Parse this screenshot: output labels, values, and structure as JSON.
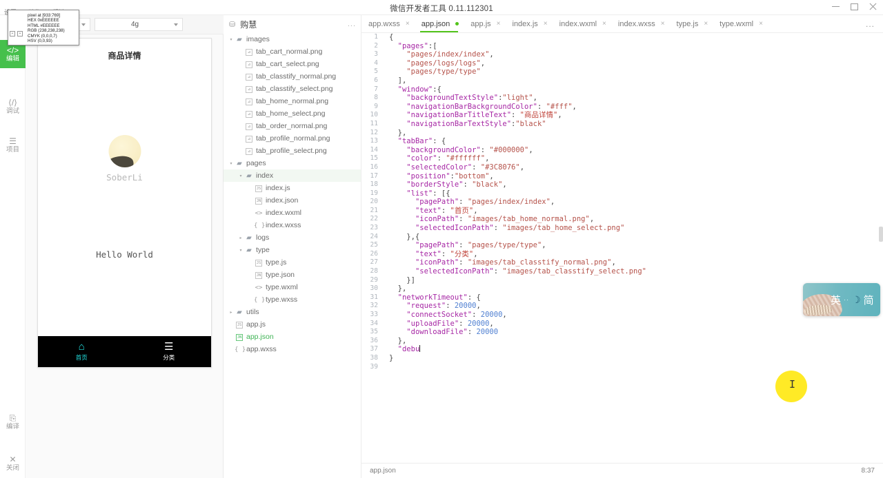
{
  "window": {
    "title": "微信开发者工具 0.11.112301",
    "controls": {
      "minimize": "minimize-icon",
      "maximize": "maximize-icon",
      "close": "close-icon"
    }
  },
  "menubar": {
    "items": [
      "设置",
      "动作",
      "超链"
    ]
  },
  "color_picker": {
    "pixel": "pixel at [933:769]",
    "hex": "HEX 0xEEEEEE",
    "html": "HTML #EEEEEE",
    "rgb": "RGB (238,238,238)",
    "cmyk": "CMYK (0,0,0,7)",
    "hsv": "HSV (0,0,93)",
    "swatch_a": "+",
    "swatch_b": "+"
  },
  "rail": {
    "items": [
      {
        "glyph": "</>",
        "label": "编辑",
        "active": true,
        "name": "rail-item-edit"
      },
      {
        "glyph": "⟨/⟩",
        "label": "调试",
        "active": false,
        "name": "rail-item-debug"
      },
      {
        "glyph": "☰",
        "label": "项目",
        "active": false,
        "name": "rail-item-project"
      }
    ],
    "bottom_items": [
      {
        "glyph": "⎘",
        "label": "编译",
        "name": "rail-item-compile"
      },
      {
        "glyph": "✕",
        "label": "关闭",
        "name": "rail-item-close"
      }
    ]
  },
  "simulator": {
    "device_select": "",
    "network_select": "4g",
    "phone": {
      "nav_title": "商品详情",
      "user_name": "SoberLi",
      "body_text": "Hello World",
      "tabbar": {
        "background": "#000000",
        "items": [
          {
            "icon": "home-icon",
            "glyph": "⌂",
            "label": "首页",
            "color": "#22e0e0",
            "selected": true
          },
          {
            "icon": "list-icon",
            "glyph": "☰",
            "label": "分类",
            "color": "#ffffff",
            "selected": false
          }
        ]
      }
    }
  },
  "explorer": {
    "project_name": "购慧",
    "more_label": "...",
    "tree": [
      {
        "depth": 0,
        "twisty": "▾",
        "icon": "folder",
        "label": "images"
      },
      {
        "depth": 1,
        "twisty": "",
        "icon": "png",
        "label": "tab_cart_normal.png"
      },
      {
        "depth": 1,
        "twisty": "",
        "icon": "png",
        "label": "tab_cart_select.png"
      },
      {
        "depth": 1,
        "twisty": "",
        "icon": "png",
        "label": "tab_classtify_normal.png"
      },
      {
        "depth": 1,
        "twisty": "",
        "icon": "png",
        "label": "tab_classtify_select.png"
      },
      {
        "depth": 1,
        "twisty": "",
        "icon": "png",
        "label": "tab_home_normal.png"
      },
      {
        "depth": 1,
        "twisty": "",
        "icon": "png",
        "label": "tab_home_select.png"
      },
      {
        "depth": 1,
        "twisty": "",
        "icon": "png",
        "label": "tab_order_normal.png"
      },
      {
        "depth": 1,
        "twisty": "",
        "icon": "png",
        "label": "tab_profile_normal.png"
      },
      {
        "depth": 1,
        "twisty": "",
        "icon": "png",
        "label": "tab_profile_select.png"
      },
      {
        "depth": 0,
        "twisty": "▾",
        "icon": "folder",
        "label": "pages"
      },
      {
        "depth": 1,
        "twisty": "▾",
        "icon": "folder",
        "label": "index",
        "selected": true
      },
      {
        "depth": 2,
        "twisty": "",
        "icon": "js",
        "label": "index.js"
      },
      {
        "depth": 2,
        "twisty": "",
        "icon": "json",
        "label": "index.json"
      },
      {
        "depth": 2,
        "twisty": "",
        "icon": "wxml",
        "label": "index.wxml"
      },
      {
        "depth": 2,
        "twisty": "",
        "icon": "wxss",
        "label": "index.wxss"
      },
      {
        "depth": 1,
        "twisty": "▸",
        "icon": "folder",
        "label": "logs"
      },
      {
        "depth": 1,
        "twisty": "▾",
        "icon": "folder",
        "label": "type"
      },
      {
        "depth": 2,
        "twisty": "",
        "icon": "js",
        "label": "type.js"
      },
      {
        "depth": 2,
        "twisty": "",
        "icon": "json",
        "label": "type.json"
      },
      {
        "depth": 2,
        "twisty": "",
        "icon": "wxml",
        "label": "type.wxml"
      },
      {
        "depth": 2,
        "twisty": "",
        "icon": "wxss",
        "label": "type.wxss"
      },
      {
        "depth": 0,
        "twisty": "▸",
        "icon": "folder",
        "label": "utils"
      },
      {
        "depth": 0,
        "twisty": "",
        "icon": "js",
        "label": "app.js"
      },
      {
        "depth": 0,
        "twisty": "",
        "icon": "json",
        "label": "app.json",
        "active": true
      },
      {
        "depth": 0,
        "twisty": "",
        "icon": "wxss",
        "label": "app.wxss"
      }
    ]
  },
  "editor": {
    "tabs": [
      {
        "label": "app.wxss",
        "active": false,
        "modified": false
      },
      {
        "label": "app.json",
        "active": true,
        "modified": true
      },
      {
        "label": "app.js",
        "active": false,
        "modified": false
      },
      {
        "label": "index.js",
        "active": false,
        "modified": false
      },
      {
        "label": "index.wxml",
        "active": false,
        "modified": false
      },
      {
        "label": "index.wxss",
        "active": false,
        "modified": false
      },
      {
        "label": "type.js",
        "active": false,
        "modified": false
      },
      {
        "label": "type.wxml",
        "active": false,
        "modified": false
      }
    ],
    "overflow_label": "...",
    "close_glyph": "×",
    "lines": [
      {
        "no": 1,
        "tokens": [
          {
            "t": "p",
            "v": "{"
          }
        ]
      },
      {
        "no": 2,
        "tokens": [
          {
            "t": "p",
            "v": "  "
          },
          {
            "t": "k",
            "v": "\"pages\""
          },
          {
            "t": "p",
            "v": ":["
          }
        ]
      },
      {
        "no": 3,
        "tokens": [
          {
            "t": "p",
            "v": "    "
          },
          {
            "t": "s",
            "v": "\"pages/index/index\""
          },
          {
            "t": "p",
            "v": ","
          }
        ]
      },
      {
        "no": 4,
        "tokens": [
          {
            "t": "p",
            "v": "    "
          },
          {
            "t": "s",
            "v": "\"pages/logs/logs\""
          },
          {
            "t": "p",
            "v": ","
          }
        ]
      },
      {
        "no": 5,
        "tokens": [
          {
            "t": "p",
            "v": "    "
          },
          {
            "t": "s",
            "v": "\"pages/type/type\""
          }
        ]
      },
      {
        "no": 6,
        "tokens": [
          {
            "t": "p",
            "v": "  ],"
          }
        ]
      },
      {
        "no": 7,
        "tokens": [
          {
            "t": "p",
            "v": "  "
          },
          {
            "t": "k",
            "v": "\"window\""
          },
          {
            "t": "p",
            "v": ":{"
          }
        ]
      },
      {
        "no": 8,
        "tokens": [
          {
            "t": "p",
            "v": "    "
          },
          {
            "t": "k",
            "v": "\"backgroundTextStyle\""
          },
          {
            "t": "p",
            "v": ":"
          },
          {
            "t": "s",
            "v": "\"light\""
          },
          {
            "t": "p",
            "v": ","
          }
        ]
      },
      {
        "no": 9,
        "tokens": [
          {
            "t": "p",
            "v": "    "
          },
          {
            "t": "k",
            "v": "\"navigationBarBackgroundColor\""
          },
          {
            "t": "p",
            "v": ": "
          },
          {
            "t": "s",
            "v": "\"#fff\""
          },
          {
            "t": "p",
            "v": ","
          }
        ]
      },
      {
        "no": 10,
        "tokens": [
          {
            "t": "p",
            "v": "    "
          },
          {
            "t": "k",
            "v": "\"navigationBarTitleText\""
          },
          {
            "t": "p",
            "v": ": "
          },
          {
            "t": "cn",
            "v": "\"商品详情\""
          },
          {
            "t": "p",
            "v": ","
          }
        ]
      },
      {
        "no": 11,
        "tokens": [
          {
            "t": "p",
            "v": "    "
          },
          {
            "t": "k",
            "v": "\"navigationBarTextStyle\""
          },
          {
            "t": "p",
            "v": ":"
          },
          {
            "t": "s",
            "v": "\"black\""
          }
        ]
      },
      {
        "no": 12,
        "tokens": [
          {
            "t": "p",
            "v": "  },"
          }
        ]
      },
      {
        "no": 13,
        "tokens": [
          {
            "t": "p",
            "v": "  "
          },
          {
            "t": "k",
            "v": "\"tabBar\""
          },
          {
            "t": "p",
            "v": ": {"
          }
        ]
      },
      {
        "no": 14,
        "tokens": [
          {
            "t": "p",
            "v": "    "
          },
          {
            "t": "k",
            "v": "\"backgroundColor\""
          },
          {
            "t": "p",
            "v": ": "
          },
          {
            "t": "s",
            "v": "\"#000000\""
          },
          {
            "t": "p",
            "v": ","
          }
        ]
      },
      {
        "no": 15,
        "tokens": [
          {
            "t": "p",
            "v": "    "
          },
          {
            "t": "k",
            "v": "\"color\""
          },
          {
            "t": "p",
            "v": ": "
          },
          {
            "t": "s",
            "v": "\"#ffffff\""
          },
          {
            "t": "p",
            "v": ","
          }
        ]
      },
      {
        "no": 16,
        "tokens": [
          {
            "t": "p",
            "v": "    "
          },
          {
            "t": "k",
            "v": "\"selectedColor\""
          },
          {
            "t": "p",
            "v": ": "
          },
          {
            "t": "s",
            "v": "\"#3C8076\""
          },
          {
            "t": "p",
            "v": ","
          }
        ]
      },
      {
        "no": 17,
        "tokens": [
          {
            "t": "p",
            "v": "    "
          },
          {
            "t": "k",
            "v": "\"position\""
          },
          {
            "t": "p",
            "v": ":"
          },
          {
            "t": "s",
            "v": "\"bottom\""
          },
          {
            "t": "p",
            "v": ","
          }
        ]
      },
      {
        "no": 18,
        "tokens": [
          {
            "t": "p",
            "v": "    "
          },
          {
            "t": "k",
            "v": "\"borderStyle\""
          },
          {
            "t": "p",
            "v": ": "
          },
          {
            "t": "s",
            "v": "\"black\""
          },
          {
            "t": "p",
            "v": ","
          }
        ]
      },
      {
        "no": 19,
        "tokens": [
          {
            "t": "p",
            "v": "    "
          },
          {
            "t": "k",
            "v": "\"list\""
          },
          {
            "t": "p",
            "v": ": [{"
          }
        ]
      },
      {
        "no": 20,
        "tokens": [
          {
            "t": "p",
            "v": "      "
          },
          {
            "t": "k",
            "v": "\"pagePath\""
          },
          {
            "t": "p",
            "v": ": "
          },
          {
            "t": "s",
            "v": "\"pages/index/index\""
          },
          {
            "t": "p",
            "v": ","
          }
        ]
      },
      {
        "no": 21,
        "tokens": [
          {
            "t": "p",
            "v": "      "
          },
          {
            "t": "k",
            "v": "\"text\""
          },
          {
            "t": "p",
            "v": ": "
          },
          {
            "t": "cn",
            "v": "\"首页\""
          },
          {
            "t": "p",
            "v": ","
          }
        ]
      },
      {
        "no": 22,
        "tokens": [
          {
            "t": "p",
            "v": "      "
          },
          {
            "t": "k",
            "v": "\"iconPath\""
          },
          {
            "t": "p",
            "v": ": "
          },
          {
            "t": "s",
            "v": "\"images/tab_home_normal.png\""
          },
          {
            "t": "p",
            "v": ","
          }
        ]
      },
      {
        "no": 23,
        "tokens": [
          {
            "t": "p",
            "v": "      "
          },
          {
            "t": "k",
            "v": "\"selectedIconPath\""
          },
          {
            "t": "p",
            "v": ": "
          },
          {
            "t": "s",
            "v": "\"images/tab_home_select.png\""
          }
        ]
      },
      {
        "no": 24,
        "tokens": [
          {
            "t": "p",
            "v": "    },{"
          }
        ]
      },
      {
        "no": 25,
        "tokens": [
          {
            "t": "p",
            "v": "      "
          },
          {
            "t": "k",
            "v": "\"pagePath\""
          },
          {
            "t": "p",
            "v": ": "
          },
          {
            "t": "s",
            "v": "\"pages/type/type\""
          },
          {
            "t": "p",
            "v": ","
          }
        ]
      },
      {
        "no": 26,
        "tokens": [
          {
            "t": "p",
            "v": "      "
          },
          {
            "t": "k",
            "v": "\"text\""
          },
          {
            "t": "p",
            "v": ": "
          },
          {
            "t": "cn",
            "v": "\"分类\""
          },
          {
            "t": "p",
            "v": ","
          }
        ]
      },
      {
        "no": 27,
        "tokens": [
          {
            "t": "p",
            "v": "      "
          },
          {
            "t": "k",
            "v": "\"iconPath\""
          },
          {
            "t": "p",
            "v": ": "
          },
          {
            "t": "s",
            "v": "\"images/tab_classtify_normal.png\""
          },
          {
            "t": "p",
            "v": ","
          }
        ]
      },
      {
        "no": 28,
        "tokens": [
          {
            "t": "p",
            "v": "      "
          },
          {
            "t": "k",
            "v": "\"selectedIconPath\""
          },
          {
            "t": "p",
            "v": ": "
          },
          {
            "t": "s",
            "v": "\"images/tab_classtify_select.png\""
          }
        ]
      },
      {
        "no": 29,
        "tokens": [
          {
            "t": "p",
            "v": "    }]"
          }
        ]
      },
      {
        "no": 30,
        "tokens": [
          {
            "t": "p",
            "v": "  },"
          }
        ]
      },
      {
        "no": 31,
        "tokens": [
          {
            "t": "p",
            "v": "  "
          },
          {
            "t": "k",
            "v": "\"networkTimeout\""
          },
          {
            "t": "p",
            "v": ": {"
          }
        ]
      },
      {
        "no": 32,
        "tokens": [
          {
            "t": "p",
            "v": "    "
          },
          {
            "t": "k",
            "v": "\"request\""
          },
          {
            "t": "p",
            "v": ": "
          },
          {
            "t": "n",
            "v": "20000"
          },
          {
            "t": "p",
            "v": ","
          }
        ]
      },
      {
        "no": 33,
        "tokens": [
          {
            "t": "p",
            "v": "    "
          },
          {
            "t": "k",
            "v": "\"connectSocket\""
          },
          {
            "t": "p",
            "v": ": "
          },
          {
            "t": "n",
            "v": "20000"
          },
          {
            "t": "p",
            "v": ","
          }
        ]
      },
      {
        "no": 34,
        "tokens": [
          {
            "t": "p",
            "v": "    "
          },
          {
            "t": "k",
            "v": "\"uploadFile\""
          },
          {
            "t": "p",
            "v": ": "
          },
          {
            "t": "n",
            "v": "20000"
          },
          {
            "t": "p",
            "v": ","
          }
        ]
      },
      {
        "no": 35,
        "tokens": [
          {
            "t": "p",
            "v": "    "
          },
          {
            "t": "k",
            "v": "\"downloadFile\""
          },
          {
            "t": "p",
            "v": ": "
          },
          {
            "t": "n",
            "v": "20000"
          }
        ]
      },
      {
        "no": 36,
        "tokens": [
          {
            "t": "p",
            "v": "  },"
          }
        ]
      },
      {
        "no": 37,
        "tokens": [
          {
            "t": "p",
            "v": "  "
          },
          {
            "t": "k",
            "v": "\"debu"
          }
        ],
        "caret": true
      },
      {
        "no": 38,
        "tokens": [
          {
            "t": "p",
            "v": "}"
          }
        ]
      },
      {
        "no": 39,
        "tokens": []
      }
    ]
  },
  "statusbar": {
    "file": "app.json",
    "time": "8:37"
  },
  "ime": {
    "lang": "英",
    "dots": "··",
    "moon": "☽",
    "mode": "简"
  }
}
